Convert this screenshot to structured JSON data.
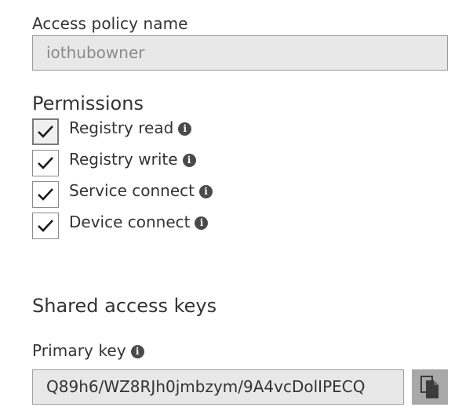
{
  "access_policy": {
    "label": "Access policy name",
    "value": "iothubowner"
  },
  "permissions": {
    "heading": "Permissions",
    "items": [
      {
        "label": "Registry read",
        "checked": true
      },
      {
        "label": "Registry write",
        "checked": true
      },
      {
        "label": "Service connect",
        "checked": true
      },
      {
        "label": "Device connect",
        "checked": true
      }
    ]
  },
  "shared_access_keys": {
    "heading": "Shared access keys",
    "primary_key_label": "Primary key",
    "primary_key_value": "Q89h6/WZ8RJh0jmbzym/9A4vcDolIPECQ"
  },
  "icons": {
    "info": "info-icon",
    "check": "checkmark-icon",
    "copy": "copy-icon"
  },
  "colors": {
    "input_background": "#e8e8e8",
    "copy_button_background": "#a8a8a8",
    "icon_dark": "#4a4a4a"
  }
}
